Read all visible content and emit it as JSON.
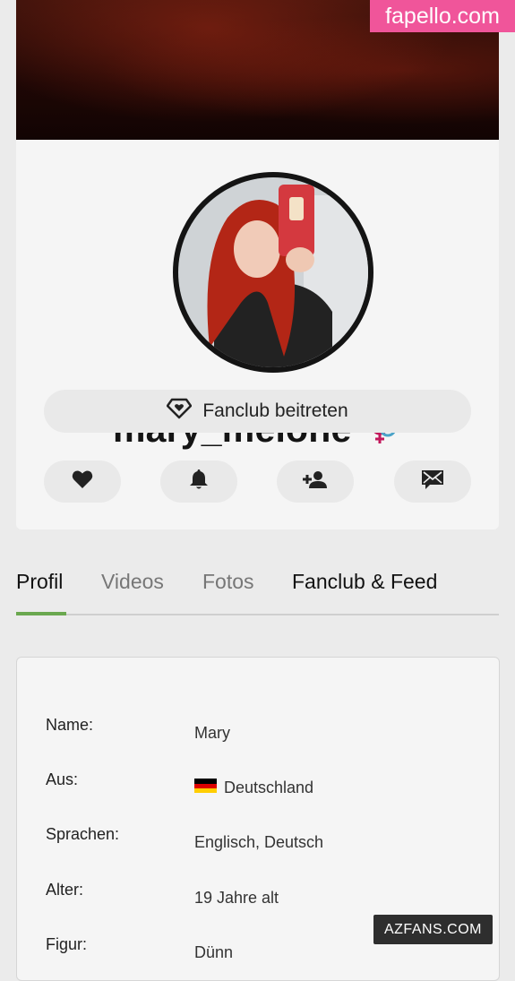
{
  "watermark_top": "fapello.com",
  "watermark_bottom": "AZFANS.COM",
  "profile": {
    "username": "mary_melone",
    "gender_icon": "gender-symbol-icon",
    "fanclub_button": "Fanclub beitreten"
  },
  "actions": [
    {
      "name": "like-button",
      "icon": "heart-icon"
    },
    {
      "name": "notify-button",
      "icon": "bell-icon"
    },
    {
      "name": "follow-button",
      "icon": "add-person-icon"
    },
    {
      "name": "message-button",
      "icon": "envelope-icon"
    }
  ],
  "tabs": [
    {
      "label": "Profil",
      "active": true
    },
    {
      "label": "Videos",
      "active": false
    },
    {
      "label": "Fotos",
      "active": false
    },
    {
      "label": "Fanclub & Feed",
      "active": false
    }
  ],
  "details": [
    {
      "label": "Name:",
      "value": "Mary"
    },
    {
      "label": "Aus:",
      "value": "Deutschland"
    },
    {
      "label": "Sprachen:",
      "value": "Englisch, Deutsch"
    },
    {
      "label": "Alter:",
      "value": "19 Jahre alt"
    },
    {
      "label": "Figur:",
      "value": "Dünn"
    }
  ],
  "colors": {
    "accent_tab": "#6aa84f",
    "watermark_pink": "#f0559a",
    "gender_pink": "#c2185b",
    "gender_blue": "#4aa3c8"
  }
}
